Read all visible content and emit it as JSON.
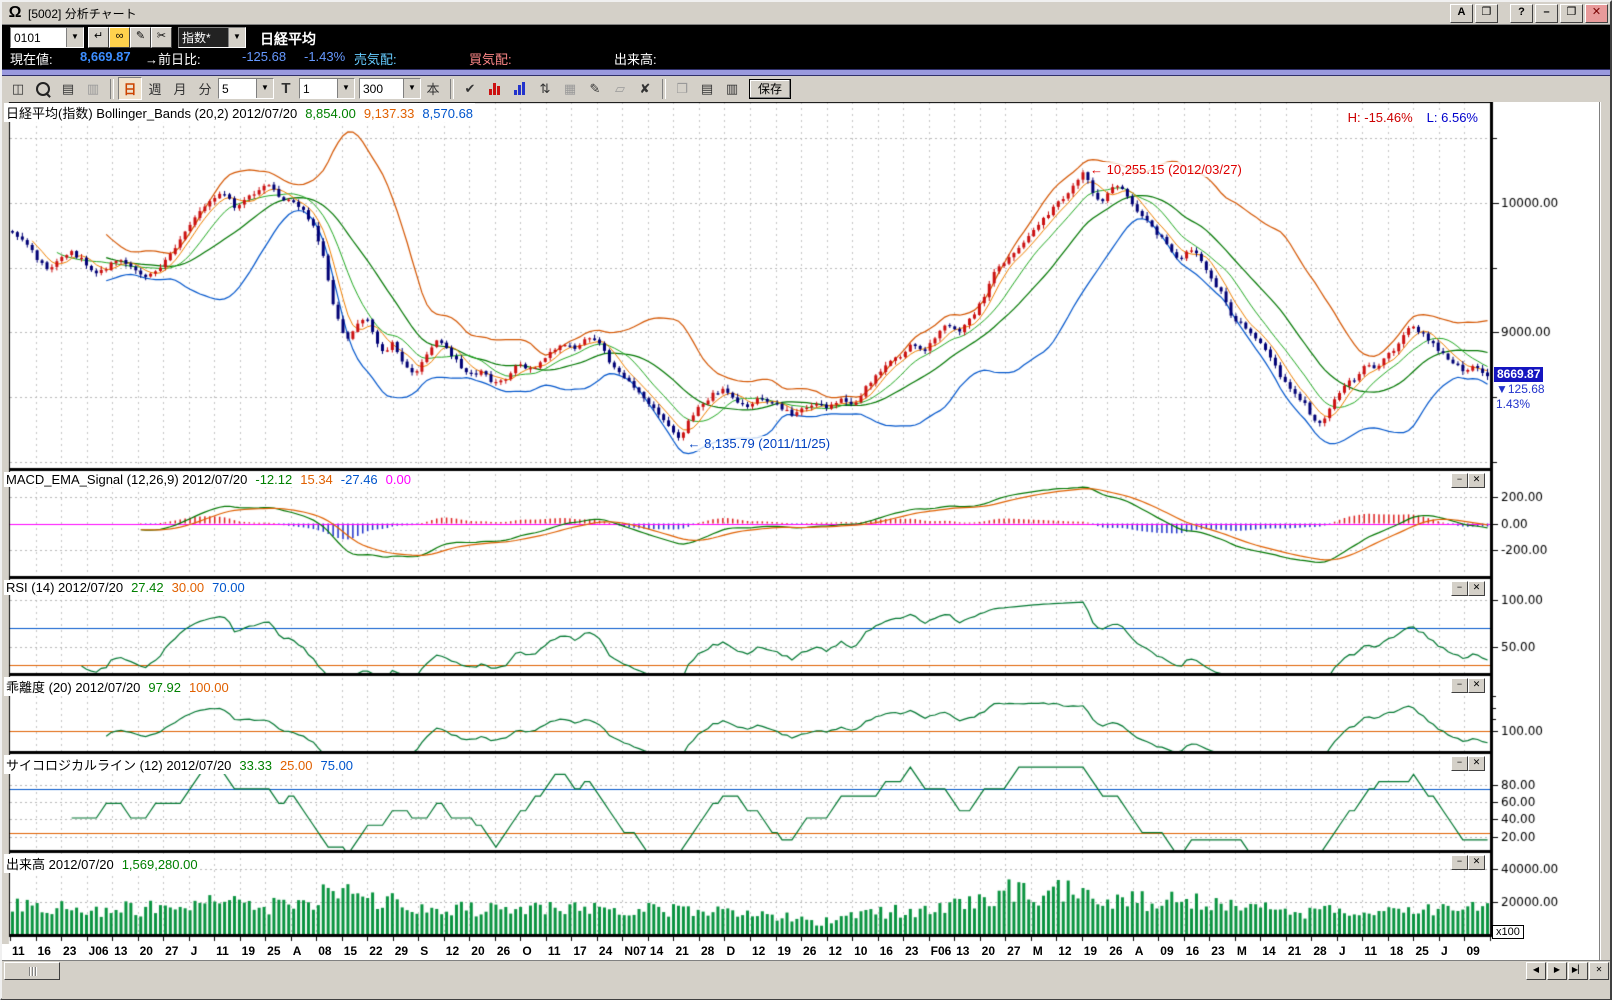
{
  "window": {
    "title": "[5002] 分析チャート"
  },
  "icons": {
    "logo": "Ω",
    "font": "A",
    "copy": "❐",
    "help": "?",
    "minimize": "–",
    "restore": "❐",
    "close": "✕",
    "enter": "↵",
    "binoculars": "∞",
    "memo": "✎",
    "scissors": "✂",
    "dropdown": "▼",
    "candlestick": "◫",
    "page_new": "▤",
    "page_copy": "▥",
    "check": "✔",
    "updown": "⇅",
    "grid": "▦",
    "pencil": "✎",
    "eraser": "▱",
    "delete": "✘",
    "layout": "❐",
    "left_arrow": "←",
    "scroll_left": "◀",
    "scroll_right": "▶",
    "scroll_end": "▶▏",
    "small_close": "✕",
    "panel_min": "−",
    "panel_close": "✕"
  },
  "quote_bar": {
    "code_value": "0101",
    "index_dropdown": "指数*",
    "symbol_name": "日経平均",
    "current_label": "現在値:",
    "current_value": "8,669.87",
    "prev_diff_label": "→前日比:",
    "diff_value": "-125.68",
    "diff_pct": "-1.43%",
    "ask_label": "売気配:",
    "bid_label": "買気配:",
    "volume_label": "出来高:"
  },
  "toolbar": {
    "period_day": "日",
    "period_week": "週",
    "period_month": "月",
    "period_minute": "分",
    "minute_value": "5",
    "t_label": "T",
    "t_value": "1",
    "bars_value": "300",
    "bars_label": "本",
    "save_label": "保存"
  },
  "hl": {
    "high": "H: -15.46%",
    "low": "L: 6.56%"
  },
  "annotations": {
    "high_text": "10,255.15 (2012/03/27)",
    "low_text": "8,135.79 (2011/11/25)"
  },
  "price_marker": {
    "price_text": "8669.87",
    "change_text": "▼125.68",
    "pct_text": "1.43%"
  },
  "volume_unit": "x100",
  "panels": [
    {
      "key": "price",
      "header": "日経平均(指数) Bollinger_Bands (20,2) 2012/07/20",
      "values": [
        {
          "text": "8,854.00",
          "color": "#008000"
        },
        {
          "text": "9,137.33",
          "color": "#e06000"
        },
        {
          "text": "8,570.68",
          "color": "#0055cc"
        }
      ],
      "controls": false
    },
    {
      "key": "macd",
      "header": "MACD_EMA_Signal (12,26,9) 2012/07/20",
      "values": [
        {
          "text": "-12.12",
          "color": "#008000"
        },
        {
          "text": "15.34",
          "color": "#e06000"
        },
        {
          "text": "-27.46",
          "color": "#0055cc"
        },
        {
          "text": "0.00",
          "color": "#ff00ff"
        }
      ],
      "controls": true
    },
    {
      "key": "rsi",
      "header": "RSI (14) 2012/07/20",
      "values": [
        {
          "text": "27.42",
          "color": "#008000"
        },
        {
          "text": "30.00",
          "color": "#e06000"
        },
        {
          "text": "70.00",
          "color": "#0055cc"
        }
      ],
      "controls": true
    },
    {
      "key": "kairi",
      "header": "乖離度 (20) 2012/07/20",
      "values": [
        {
          "text": "97.92",
          "color": "#008000"
        },
        {
          "text": "100.00",
          "color": "#e06000"
        }
      ],
      "controls": true
    },
    {
      "key": "psych",
      "header": "サイコロジカルライン (12) 2012/07/20",
      "values": [
        {
          "text": "33.33",
          "color": "#008000"
        },
        {
          "text": "25.00",
          "color": "#e06000"
        },
        {
          "text": "75.00",
          "color": "#0055cc"
        }
      ],
      "controls": true
    },
    {
      "key": "vol",
      "header": "出来高 2012/07/20",
      "values": [
        {
          "text": "1,569,280.00",
          "color": "#008000"
        }
      ],
      "controls": true
    }
  ],
  "chart_data": {
    "type": "candlestick+indicators",
    "bars": 300,
    "last": {
      "price": 8669.87,
      "change": -125.68
    },
    "colors": {
      "up": "#cc1111",
      "down": "#000075",
      "sma5": "#f08000",
      "sma10": "#22aa22",
      "sma20": "#007700",
      "bb_upper": "#d45500",
      "bb_lower": "#0055cc",
      "macd": "#007700",
      "signal": "#e06000",
      "zero": "#ff00ff",
      "hist_pos": "#dd2222",
      "hist_neg": "#2233cc",
      "line_green": "#007730",
      "thr_hi": "#0055cc",
      "thr_lo": "#e06000",
      "volume": "#0a9440",
      "grid_v": "#c6c6c6",
      "grid_h": "#b8b8b8"
    },
    "price": {
      "range": [
        7950,
        10780
      ],
      "grid_step": 500,
      "yticks": [
        {
          "v": 10000,
          "label": "10000.00"
        },
        {
          "v": 9000,
          "label": "9000.00"
        }
      ],
      "anchors": [
        [
          0.0,
          9780
        ],
        [
          0.008,
          9700
        ],
        [
          0.016,
          9580
        ],
        [
          0.024,
          9480
        ],
        [
          0.032,
          9560
        ],
        [
          0.04,
          9620
        ],
        [
          0.048,
          9560
        ],
        [
          0.056,
          9440
        ],
        [
          0.064,
          9500
        ],
        [
          0.072,
          9560
        ],
        [
          0.08,
          9500
        ],
        [
          0.088,
          9430
        ],
        [
          0.096,
          9450
        ],
        [
          0.104,
          9570
        ],
        [
          0.112,
          9690
        ],
        [
          0.12,
          9830
        ],
        [
          0.128,
          9960
        ],
        [
          0.136,
          10030
        ],
        [
          0.144,
          10080
        ],
        [
          0.15,
          9970
        ],
        [
          0.158,
          10030
        ],
        [
          0.166,
          10090
        ],
        [
          0.172,
          10140
        ],
        [
          0.18,
          10060
        ],
        [
          0.188,
          10010
        ],
        [
          0.196,
          9950
        ],
        [
          0.204,
          9830
        ],
        [
          0.21,
          9620
        ],
        [
          0.216,
          9280
        ],
        [
          0.222,
          9050
        ],
        [
          0.228,
          8930
        ],
        [
          0.234,
          9070
        ],
        [
          0.24,
          9120
        ],
        [
          0.246,
          8960
        ],
        [
          0.252,
          8820
        ],
        [
          0.258,
          8920
        ],
        [
          0.264,
          8780
        ],
        [
          0.272,
          8660
        ],
        [
          0.28,
          8810
        ],
        [
          0.288,
          8960
        ],
        [
          0.294,
          8890
        ],
        [
          0.302,
          8760
        ],
        [
          0.31,
          8660
        ],
        [
          0.318,
          8710
        ],
        [
          0.326,
          8590
        ],
        [
          0.334,
          8640
        ],
        [
          0.342,
          8760
        ],
        [
          0.35,
          8700
        ],
        [
          0.358,
          8760
        ],
        [
          0.366,
          8860
        ],
        [
          0.374,
          8920
        ],
        [
          0.382,
          8860
        ],
        [
          0.39,
          8980
        ],
        [
          0.398,
          8900
        ],
        [
          0.406,
          8760
        ],
        [
          0.414,
          8660
        ],
        [
          0.422,
          8560
        ],
        [
          0.43,
          8460
        ],
        [
          0.438,
          8360
        ],
        [
          0.446,
          8260
        ],
        [
          0.452,
          8170
        ],
        [
          0.458,
          8320
        ],
        [
          0.466,
          8420
        ],
        [
          0.474,
          8510
        ],
        [
          0.482,
          8560
        ],
        [
          0.49,
          8460
        ],
        [
          0.498,
          8420
        ],
        [
          0.506,
          8490
        ],
        [
          0.514,
          8460
        ],
        [
          0.522,
          8410
        ],
        [
          0.53,
          8360
        ],
        [
          0.538,
          8430
        ],
        [
          0.546,
          8450
        ],
        [
          0.554,
          8420
        ],
        [
          0.562,
          8480
        ],
        [
          0.57,
          8440
        ],
        [
          0.578,
          8560
        ],
        [
          0.586,
          8660
        ],
        [
          0.594,
          8760
        ],
        [
          0.602,
          8820
        ],
        [
          0.61,
          8900
        ],
        [
          0.618,
          8860
        ],
        [
          0.626,
          8960
        ],
        [
          0.634,
          9060
        ],
        [
          0.642,
          9010
        ],
        [
          0.65,
          9110
        ],
        [
          0.658,
          9260
        ],
        [
          0.666,
          9460
        ],
        [
          0.674,
          9560
        ],
        [
          0.682,
          9660
        ],
        [
          0.69,
          9760
        ],
        [
          0.698,
          9860
        ],
        [
          0.706,
          9960
        ],
        [
          0.714,
          10060
        ],
        [
          0.722,
          10160
        ],
        [
          0.727,
          10240
        ],
        [
          0.732,
          10090
        ],
        [
          0.738,
          10000
        ],
        [
          0.744,
          10090
        ],
        [
          0.75,
          10140
        ],
        [
          0.756,
          10040
        ],
        [
          0.762,
          9940
        ],
        [
          0.77,
          9840
        ],
        [
          0.778,
          9740
        ],
        [
          0.786,
          9630
        ],
        [
          0.792,
          9540
        ],
        [
          0.798,
          9640
        ],
        [
          0.804,
          9590
        ],
        [
          0.812,
          9440
        ],
        [
          0.82,
          9290
        ],
        [
          0.828,
          9090
        ],
        [
          0.836,
          9040
        ],
        [
          0.844,
          8940
        ],
        [
          0.852,
          8840
        ],
        [
          0.86,
          8640
        ],
        [
          0.868,
          8540
        ],
        [
          0.876,
          8440
        ],
        [
          0.882,
          8340
        ],
        [
          0.888,
          8290
        ],
        [
          0.894,
          8450
        ],
        [
          0.9,
          8550
        ],
        [
          0.906,
          8610
        ],
        [
          0.912,
          8660
        ],
        [
          0.918,
          8760
        ],
        [
          0.924,
          8710
        ],
        [
          0.93,
          8810
        ],
        [
          0.936,
          8860
        ],
        [
          0.942,
          8960
        ],
        [
          0.948,
          9060
        ],
        [
          0.954,
          9010
        ],
        [
          0.96,
          8950
        ],
        [
          0.966,
          8860
        ],
        [
          0.972,
          8810
        ],
        [
          0.978,
          8760
        ],
        [
          0.984,
          8700
        ],
        [
          0.99,
          8730
        ],
        [
          1.0,
          8670
        ]
      ]
    },
    "macd": {
      "params": [
        12,
        26,
        9
      ],
      "range": [
        -400,
        400
      ],
      "yticks": [
        {
          "v": 200,
          "label": "200.00"
        },
        {
          "v": 0,
          "label": "0.00"
        },
        {
          "v": -200,
          "label": "-200.00"
        }
      ]
    },
    "rsi": {
      "period": 14,
      "range": [
        22,
        122
      ],
      "upper": 70,
      "lower": 30,
      "yticks": [
        {
          "v": 100,
          "label": "100.00"
        },
        {
          "v": 50,
          "label": "50.00"
        }
      ]
    },
    "kairi": {
      "period": 20,
      "range": [
        96.5,
        109.5
      ],
      "base": 100,
      "yticks": [
        {
          "v": 100,
          "label": "100.00"
        }
      ]
    },
    "psych": {
      "period": 12,
      "range": [
        5,
        115
      ],
      "upper": 75,
      "lower": 25,
      "yticks": [
        {
          "v": 80,
          "label": "80.00"
        },
        {
          "v": 60,
          "label": "60.00"
        },
        {
          "v": 40,
          "label": "40.00"
        },
        {
          "v": 20,
          "label": "20.00"
        }
      ]
    },
    "volume": {
      "range": [
        0,
        50000
      ],
      "unit": "x100",
      "yticks": [
        {
          "v": 40000,
          "label": "40000.00"
        },
        {
          "v": 20000,
          "label": "20000.00"
        }
      ],
      "anchors": [
        [
          0.0,
          17000
        ],
        [
          0.05,
          15000
        ],
        [
          0.1,
          16000
        ],
        [
          0.145,
          20000
        ],
        [
          0.18,
          17000
        ],
        [
          0.205,
          19000
        ],
        [
          0.217,
          36000
        ],
        [
          0.23,
          22000
        ],
        [
          0.26,
          19000
        ],
        [
          0.3,
          16000
        ],
        [
          0.35,
          15000
        ],
        [
          0.4,
          16000
        ],
        [
          0.45,
          14000
        ],
        [
          0.5,
          12000
        ],
        [
          0.53,
          10000
        ],
        [
          0.545,
          6000
        ],
        [
          0.56,
          11000
        ],
        [
          0.6,
          14000
        ],
        [
          0.64,
          18000
        ],
        [
          0.665,
          22000
        ],
        [
          0.685,
          30000
        ],
        [
          0.7,
          24000
        ],
        [
          0.71,
          30000
        ],
        [
          0.73,
          24000
        ],
        [
          0.75,
          22000
        ],
        [
          0.77,
          20000
        ],
        [
          0.8,
          21000
        ],
        [
          0.83,
          17000
        ],
        [
          0.86,
          15000
        ],
        [
          0.88,
          13000
        ],
        [
          0.9,
          14000
        ],
        [
          0.92,
          12000
        ],
        [
          0.94,
          13000
        ],
        [
          0.96,
          15000
        ],
        [
          0.98,
          16000
        ],
        [
          1.0,
          15700
        ]
      ]
    },
    "x_labels": [
      "11",
      "16",
      "23",
      "J06",
      "13",
      "20",
      "27",
      "J",
      "11",
      "19",
      "25",
      "A",
      "08",
      "15",
      "22",
      "29",
      "S",
      "12",
      "20",
      "26",
      "O",
      "11",
      "17",
      "24",
      "N07",
      "14",
      "21",
      "28",
      "D",
      "12",
      "19",
      "26",
      "12",
      "10",
      "16",
      "23",
      "F06",
      "13",
      "20",
      "27",
      "M",
      "12",
      "19",
      "26",
      "A",
      "09",
      "16",
      "23",
      "M",
      "14",
      "21",
      "28",
      "J",
      "11",
      "18",
      "25",
      "J",
      "09"
    ]
  }
}
